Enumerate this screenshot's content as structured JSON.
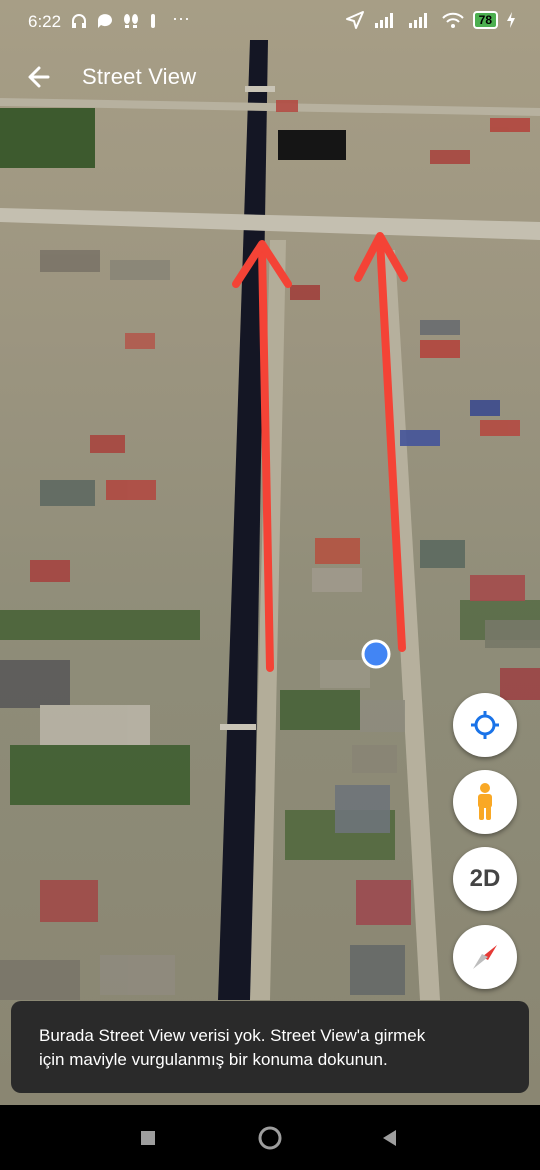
{
  "status_bar": {
    "time": "6:22",
    "battery": "78",
    "more": "···"
  },
  "header": {
    "title": "Street View",
    "back_icon": "arrow-left-icon"
  },
  "controls": {
    "locate_icon": "crosshair-icon",
    "pegman_icon": "pegman-icon",
    "view_mode": "2D",
    "compass_icon": "compass-icon"
  },
  "toast": {
    "line1": "Burada Street View verisi yok. Street View'a girmek",
    "line2": "için maviyle vurgulanmış bir konuma dokunun."
  },
  "colors": {
    "annotation_arrow": "#f44336",
    "location_dot": "#4285f4",
    "pegman": "#f9a825",
    "accent": "#1a73e8"
  }
}
